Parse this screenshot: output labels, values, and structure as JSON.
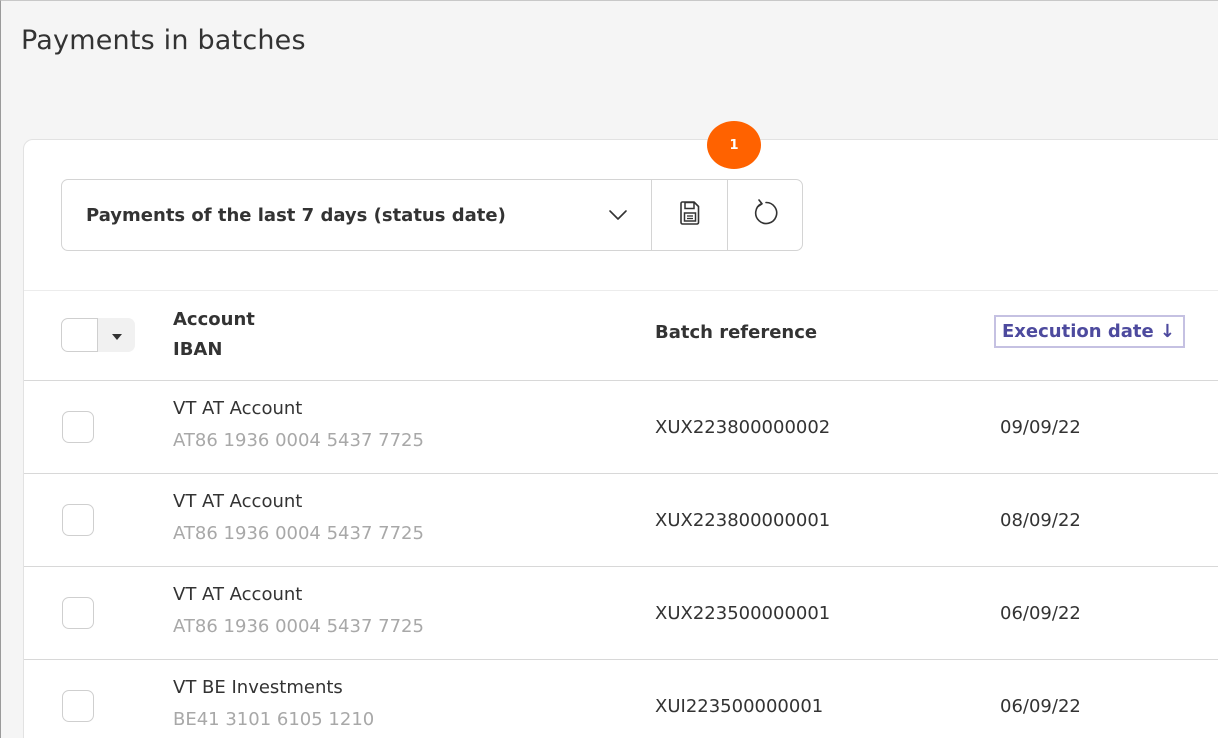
{
  "page": {
    "title": "Payments in batches"
  },
  "toolbar": {
    "filter_label": "Payments of the last 7 days (status date)",
    "badge_count": "1"
  },
  "table": {
    "headers": {
      "account": "Account",
      "iban": "IBAN",
      "batch_reference": "Batch reference",
      "execution_date": "Execution date ↓"
    },
    "rows": [
      {
        "account": "VT AT Account",
        "iban": "AT86 1936 0004 5437 7725",
        "batch_reference": "XUX223800000002",
        "execution_date": "09/09/22"
      },
      {
        "account": "VT AT Account",
        "iban": "AT86 1936 0004 5437 7725",
        "batch_reference": "XUX223800000001",
        "execution_date": "08/09/22"
      },
      {
        "account": "VT AT Account",
        "iban": "AT86 1936 0004 5437 7725",
        "batch_reference": "XUX223500000001",
        "execution_date": "06/09/22"
      },
      {
        "account": "VT BE Investments",
        "iban": "BE41 3101 6105 1210",
        "batch_reference": "XUI223500000001",
        "execution_date": "06/09/22"
      }
    ]
  },
  "icons": {
    "filter_dropdown": "chevron-down-icon",
    "save": "floppy-disk-icon",
    "reset": "reset-icon",
    "select_all_menu": "caret-down-icon"
  },
  "colors": {
    "badge": "#ff6200",
    "sort_header_text": "#4d4a9e",
    "sort_header_border": "#c5c1e2",
    "iban_text": "#a8a8a8"
  }
}
